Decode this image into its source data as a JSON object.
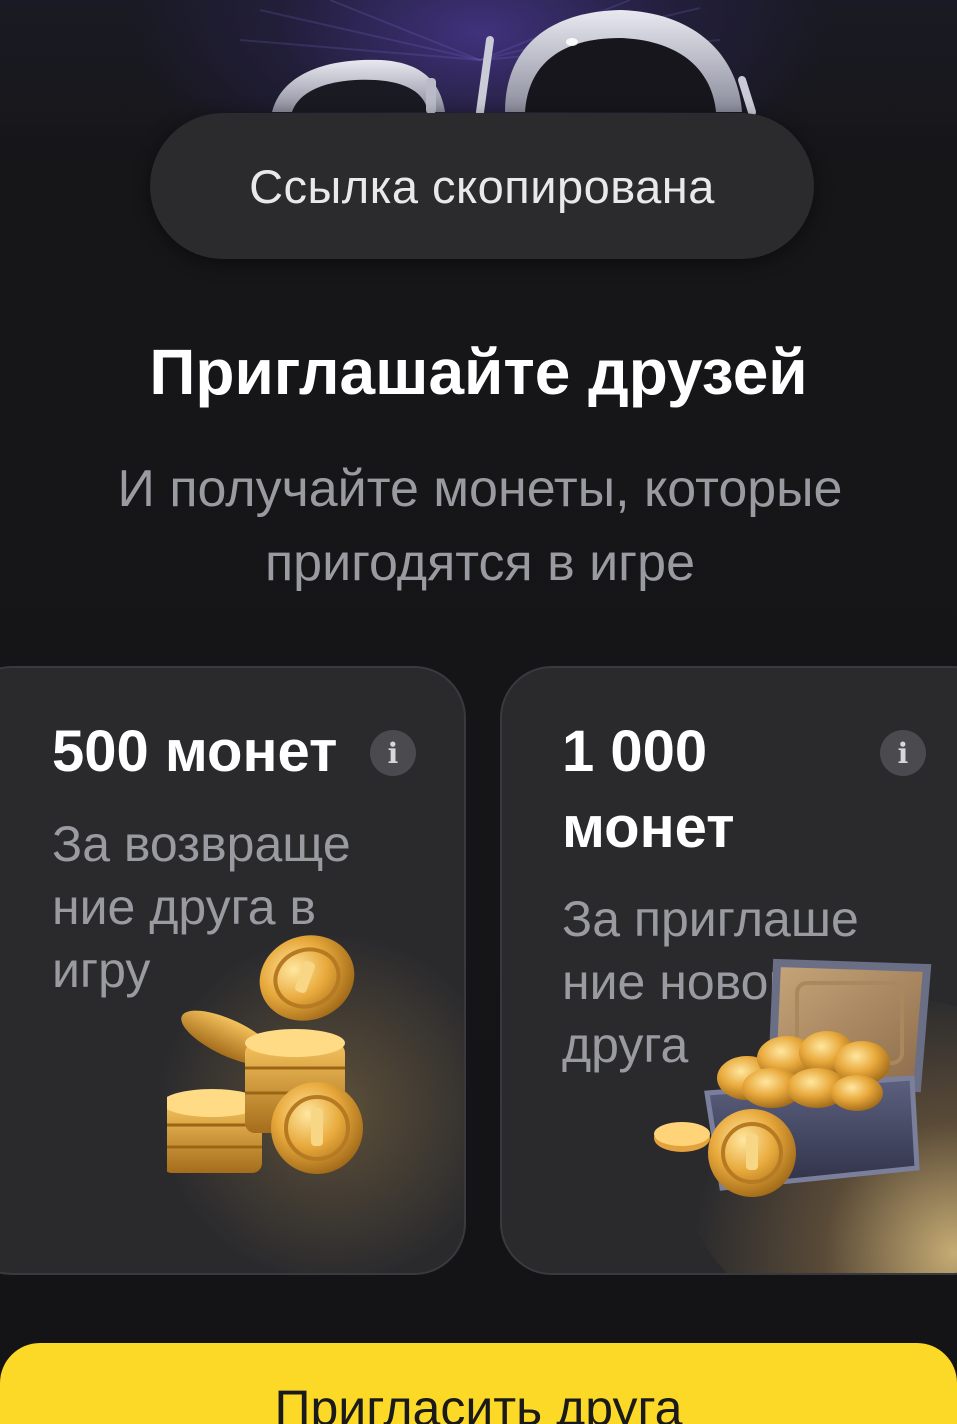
{
  "toast": {
    "text": "Ссылка скопирована"
  },
  "header": {
    "title": "Приглашайте друзей",
    "subtitle": "И получайте монеты, которые пригодятся в игре"
  },
  "cards": [
    {
      "amount": "500 монет",
      "description": "За возвраще ние друга в игру",
      "info_icon": "i"
    },
    {
      "amount": "1 000 монет",
      "description": "За приглаше ние нового друга",
      "info_icon": "i"
    }
  ],
  "cta": {
    "label": "Пригласить друга"
  },
  "colors": {
    "background": "#141416",
    "card": "#2a2a2d",
    "toast": "#2b2b2e",
    "accent_yellow": "#fcd926",
    "text_secondary": "#9a9ba0"
  }
}
